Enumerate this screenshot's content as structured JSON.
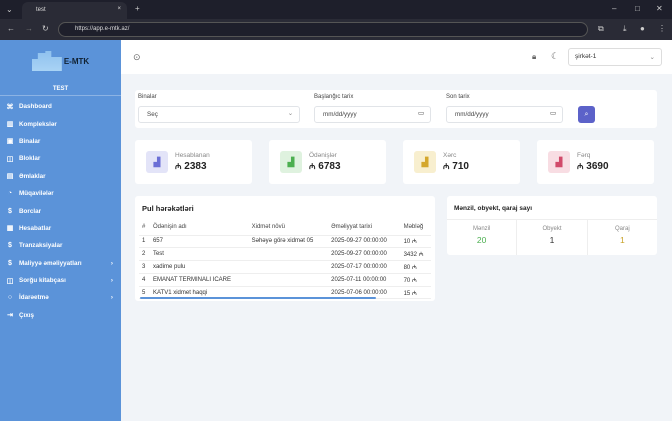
{
  "browser": {
    "tab_title": "test",
    "url": "https://app.e-mtk.az/"
  },
  "sidebar": {
    "logo": "E-MTK",
    "subtitle": "TEST",
    "items": [
      {
        "label": "Dashboard",
        "icon": "grid-icon"
      },
      {
        "label": "Komplekslər",
        "icon": "buildings-icon"
      },
      {
        "label": "Binalar",
        "icon": "building-icon"
      },
      {
        "label": "Bloklar",
        "icon": "columns-icon"
      },
      {
        "label": "Əmlaklar",
        "icon": "property-icon"
      },
      {
        "label": "Müqavilələr",
        "icon": "contract-icon"
      },
      {
        "label": "Borclar",
        "icon": "dollar-icon"
      },
      {
        "label": "Hesabatlar",
        "icon": "report-icon"
      },
      {
        "label": "Tranzaksiyalar",
        "icon": "dollar-icon"
      },
      {
        "label": "Maliyyə əməliyyatları",
        "icon": "dollar-icon",
        "has_submenu": true
      },
      {
        "label": "Sorğu kitabçası",
        "icon": "book-icon",
        "has_submenu": true
      },
      {
        "label": "İdarəetmə",
        "icon": "circle-icon",
        "has_submenu": true
      },
      {
        "label": "Çıxış",
        "icon": "logout-icon"
      }
    ]
  },
  "header": {
    "company": "şirkət-1"
  },
  "filters": {
    "buildings_label": "Binalar",
    "buildings_value": "Seç",
    "start_label": "Başlanğıc tarix",
    "start_placeholder": "mm/dd/yyyy",
    "end_label": "Son tarix",
    "end_placeholder": "mm/dd/yyyy"
  },
  "stats": [
    {
      "title": "Hesablanan",
      "value": "2383",
      "color": "#6b6fd6",
      "bg": "#e3e4f8"
    },
    {
      "title": "Ödənişlər",
      "value": "6783",
      "color": "#4caf50",
      "bg": "#dff2df"
    },
    {
      "title": "Xərc",
      "value": "710",
      "color": "#d4a72c",
      "bg": "#f8efcf"
    },
    {
      "title": "Fərq",
      "value": "3690",
      "color": "#d14a6a",
      "bg": "#f8dde3"
    }
  ],
  "currency": "₼",
  "payments": {
    "title": "Pul hərəkətləri",
    "columns": [
      "#",
      "Ödənişin adı",
      "Xidmət növü",
      "Əməliyyat tarixi",
      "Məbləğ"
    ],
    "rows": [
      [
        "1",
        "657",
        "Səhəyə görə xidmət 05",
        "2025-09-27 00:00:00",
        "10 ₼"
      ],
      [
        "2",
        "Test",
        "",
        "2025-09-27 00:00:00",
        "3432 ₼"
      ],
      [
        "3",
        "xadime pulu",
        "",
        "2025-07-17 00:00:00",
        "80 ₼"
      ],
      [
        "4",
        "EMANAT TERMINALI ICARE",
        "",
        "2025-07-11 00:00:00",
        "70 ₼"
      ],
      [
        "5",
        "KATV1 xidmet haqqi",
        "",
        "2025-07-06 00:00:00",
        "15 ₼"
      ]
    ]
  },
  "counts": {
    "title": "Mənzil, obyekt, qaraj sayı",
    "items": [
      {
        "label": "Mənzil",
        "value": "20",
        "color": "#4caf50"
      },
      {
        "label": "Obyekt",
        "value": "1",
        "color": "#333"
      },
      {
        "label": "Qaraj",
        "value": "1",
        "color": "#c9a227"
      }
    ]
  }
}
